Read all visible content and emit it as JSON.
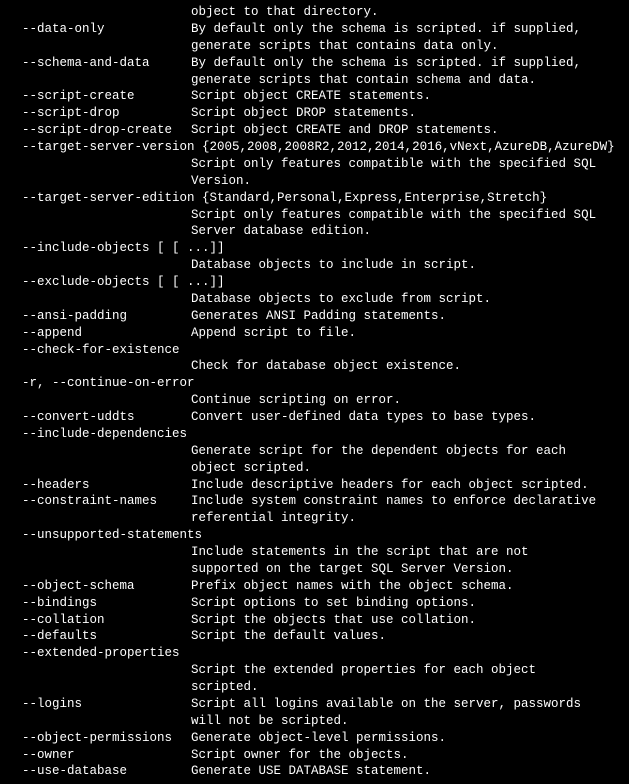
{
  "lines": [
    {
      "opt": "",
      "desc": "object to that directory."
    },
    {
      "opt": "--data-only",
      "desc": "By default only the schema is scripted. if supplied,"
    },
    {
      "opt": "",
      "desc": "generate scripts that contains data only."
    },
    {
      "opt": "--schema-and-data",
      "desc": "By default only the schema is scripted. if supplied,"
    },
    {
      "opt": "",
      "desc": "generate scripts that contain schema and data."
    },
    {
      "opt": "--script-create",
      "desc": "Script object CREATE statements."
    },
    {
      "opt": "--script-drop",
      "desc": "Script object DROP statements."
    },
    {
      "opt": "--script-drop-create",
      "desc": "Script object CREATE and DROP statements."
    },
    {
      "opt": "--target-server-version {2005,2008,2008R2,2012,2014,2016,vNext,AzureDB,AzureDW}",
      "desc": "",
      "full": true
    },
    {
      "opt": "",
      "desc": "Script only features compatible with the specified SQL"
    },
    {
      "opt": "",
      "desc": "Version."
    },
    {
      "opt": "--target-server-edition {Standard,Personal,Express,Enterprise,Stretch}",
      "desc": "",
      "full": true
    },
    {
      "opt": "",
      "desc": "Script only features compatible with the specified SQL"
    },
    {
      "opt": "",
      "desc": "Server database edition."
    },
    {
      "opt": "--include-objects [ [ ...]]",
      "desc": "",
      "full": true
    },
    {
      "opt": "",
      "desc": "Database objects to include in script."
    },
    {
      "opt": "--exclude-objects [ [ ...]]",
      "desc": "",
      "full": true
    },
    {
      "opt": "",
      "desc": "Database objects to exclude from script."
    },
    {
      "opt": "--ansi-padding",
      "desc": "Generates ANSI Padding statements."
    },
    {
      "opt": "--append",
      "desc": "Append script to file."
    },
    {
      "opt": "--check-for-existence",
      "desc": "",
      "full": true
    },
    {
      "opt": "",
      "desc": "Check for database object existence."
    },
    {
      "opt": "-r, --continue-on-error",
      "desc": "",
      "full": true
    },
    {
      "opt": "",
      "desc": "Continue scripting on error."
    },
    {
      "opt": "--convert-uddts",
      "desc": "Convert user-defined data types to base types."
    },
    {
      "opt": "--include-dependencies",
      "desc": "",
      "full": true
    },
    {
      "opt": "",
      "desc": "Generate script for the dependent objects for each"
    },
    {
      "opt": "",
      "desc": "object scripted."
    },
    {
      "opt": "--headers",
      "desc": "Include descriptive headers for each object scripted."
    },
    {
      "opt": "--constraint-names",
      "desc": "Include system constraint names to enforce declarative"
    },
    {
      "opt": "",
      "desc": "referential integrity."
    },
    {
      "opt": "--unsupported-statements",
      "desc": "",
      "full": true
    },
    {
      "opt": "",
      "desc": "Include statements in the script that are not"
    },
    {
      "opt": "",
      "desc": "supported on the target SQL Server Version."
    },
    {
      "opt": "--object-schema",
      "desc": "Prefix object names with the object schema."
    },
    {
      "opt": "--bindings",
      "desc": "Script options to set binding options."
    },
    {
      "opt": "--collation",
      "desc": "Script the objects that use collation."
    },
    {
      "opt": "--defaults",
      "desc": "Script the default values."
    },
    {
      "opt": "--extended-properties",
      "desc": "",
      "full": true
    },
    {
      "opt": "",
      "desc": "Script the extended properties for each object"
    },
    {
      "opt": "",
      "desc": "scripted."
    },
    {
      "opt": "--logins",
      "desc": "Script all logins available on the server, passwords"
    },
    {
      "opt": "",
      "desc": "will not be scripted."
    },
    {
      "opt": "--object-permissions",
      "desc": "Generate object-level permissions."
    },
    {
      "opt": "--owner",
      "desc": "Script owner for the objects."
    },
    {
      "opt": "--use-database",
      "desc": "Generate USE DATABASE statement."
    }
  ]
}
